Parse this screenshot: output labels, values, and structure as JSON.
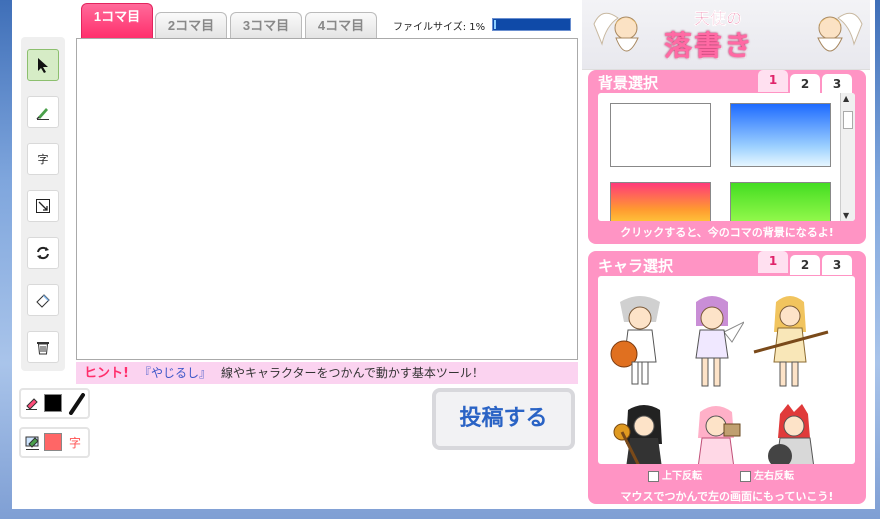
{
  "frame_tabs": [
    {
      "label": "1コマ目",
      "active": true
    },
    {
      "label": "2コマ目",
      "active": false
    },
    {
      "label": "3コマ目",
      "active": false
    },
    {
      "label": "4コマ目",
      "active": false
    }
  ],
  "file_size": {
    "label": "ファイルサイズ: 1%",
    "percent": 1
  },
  "tools": [
    {
      "name": "select",
      "icon": "arrow-cursor-icon"
    },
    {
      "name": "pen",
      "icon": "pen-icon"
    },
    {
      "name": "text",
      "icon": "text-icon",
      "label": "字"
    },
    {
      "name": "resize",
      "icon": "resize-icon"
    },
    {
      "name": "rotate",
      "icon": "rotate-icon"
    },
    {
      "name": "eraser",
      "icon": "eraser-icon"
    },
    {
      "name": "delete",
      "icon": "trash-icon"
    }
  ],
  "hint": {
    "prefix": "ヒント!",
    "tool": "『やじるし』",
    "text": "線やキャラクターをつかんで動かす基本ツール！"
  },
  "pen_color": "#000000",
  "text_color": "#ff6666",
  "text_color_label": "字",
  "submit_label": "投稿する",
  "logo": {
    "line1": "天使の",
    "line2": "落書き"
  },
  "background_panel": {
    "title": "背景選択",
    "tabs": [
      "1",
      "2",
      "3"
    ],
    "active_tab": 0,
    "footer": "クリックすると、今のコマの背景になるよ!"
  },
  "character_panel": {
    "title": "キャラ選択",
    "tabs": [
      "1",
      "2",
      "3"
    ],
    "active_tab": 0,
    "flip_vertical": "上下反転",
    "flip_horizontal": "左右反転",
    "footer": "マウスでつかんで左の画面にもっていこう!"
  },
  "colors": {
    "accent_pink": "#ff2f6c",
    "panel_pink": "#ff94c4",
    "hint_bg": "#fbd3f0",
    "button_text": "#2a63c5"
  }
}
